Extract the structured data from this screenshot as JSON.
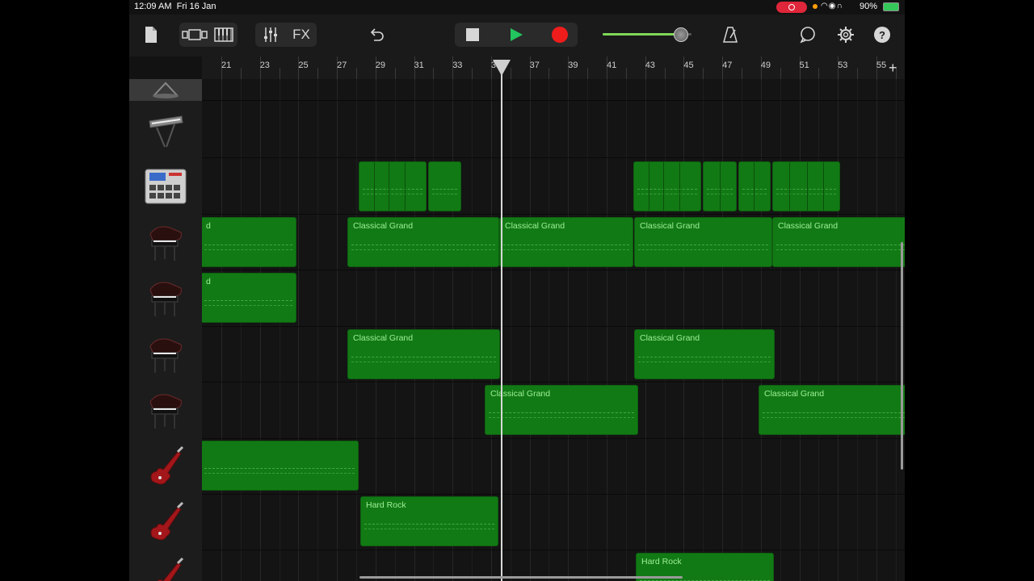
{
  "status": {
    "time": "12:09 AM",
    "date": "Fri 16 Jan",
    "battery": "90%"
  },
  "toolbar": {
    "fx_label": "FX",
    "accent_play": "#22c55e",
    "accent_record": "#ef1c1c",
    "volume_level": 0.85
  },
  "ruler": {
    "bars": [
      "21",
      "23",
      "25",
      "27",
      "29",
      "31",
      "33",
      "35",
      "37",
      "39",
      "41",
      "43",
      "45",
      "47",
      "49",
      "51",
      "53",
      "55"
    ],
    "add_label": "+"
  },
  "tracks": [
    {
      "name": "drum-kit",
      "icon": "drum-kit-icon"
    },
    {
      "name": "synth-keyboard",
      "icon": "keyboard-icon"
    },
    {
      "name": "beat-sequencer",
      "icon": "beat-sequencer-icon"
    },
    {
      "name": "piano-1",
      "icon": "grand-piano-icon"
    },
    {
      "name": "piano-2",
      "icon": "grand-piano-icon"
    },
    {
      "name": "piano-3",
      "icon": "grand-piano-icon"
    },
    {
      "name": "piano-4",
      "icon": "grand-piano-icon"
    },
    {
      "name": "guitar-1",
      "icon": "electric-guitar-icon"
    },
    {
      "name": "guitar-2",
      "icon": "electric-guitar-icon"
    },
    {
      "name": "guitar-3",
      "icon": "electric-guitar-icon"
    }
  ],
  "regions": [
    {
      "track": 2,
      "label": ""
    },
    {
      "track": 2,
      "label": ""
    },
    {
      "track": 2,
      "label": ""
    },
    {
      "track": 2,
      "label": ""
    },
    {
      "track": 2,
      "label": ""
    },
    {
      "track": 2,
      "label": ""
    },
    {
      "track": 3,
      "label": "d"
    },
    {
      "track": 3,
      "label": "Classical Grand"
    },
    {
      "track": 3,
      "label": "Classical Grand"
    },
    {
      "track": 3,
      "label": "Classical Grand"
    },
    {
      "track": 3,
      "label": "Classical Grand"
    },
    {
      "track": 4,
      "label": "d"
    },
    {
      "track": 5,
      "label": "Classical Grand"
    },
    {
      "track": 5,
      "label": "Classical Grand"
    },
    {
      "track": 6,
      "label": "Classical Grand"
    },
    {
      "track": 6,
      "label": "Classical Grand"
    },
    {
      "track": 7,
      "label": ""
    },
    {
      "track": 8,
      "label": "Hard Rock"
    },
    {
      "track": 9,
      "label": "Hard Rock"
    }
  ]
}
